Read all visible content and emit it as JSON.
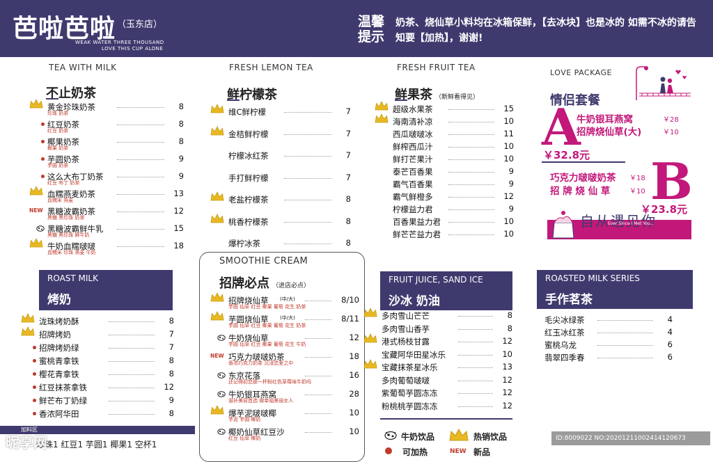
{
  "header": {
    "brand": "芭啦芭啦",
    "branch": "（玉东店）",
    "slogan_line1": "WEAK WATER THREE THOUSAND",
    "slogan_line2": "LOVE THIS CUP ALONE",
    "notice_label": "温馨提示",
    "notice_text": "奶茶、烧仙草小料均在冰箱保鲜，【去冰块】也是冰的 如需不冰的请告知要【加热】，谢谢!"
  },
  "milk_tea": {
    "en": "TEA WITH MILK",
    "cn": "不止奶茶",
    "items": [
      {
        "name": "黄金珍珠奶茶",
        "desc": "珍珠 奶茶",
        "price": "8"
      },
      {
        "name": "红豆奶茶",
        "desc": "红豆 奶茶",
        "price": "8"
      },
      {
        "name": "椰果奶茶",
        "desc": "椰果 奶茶",
        "price": "8"
      },
      {
        "name": "芋圆奶茶",
        "desc": "芋圆 奶茶",
        "price": "9"
      },
      {
        "name": "这么大布丁奶茶",
        "desc": "红豆 布丁 奶茶",
        "price": "9"
      },
      {
        "name": "血糯燕麦奶茶",
        "desc": "血糯米 燕麦",
        "price": "13"
      },
      {
        "name": "黑糖波霸奶茶",
        "desc": "黑糖 黑珍珠 奶茶",
        "price": "12"
      },
      {
        "name": "黑糖波霸鲜牛乳",
        "desc": "黑糖 黑珍珠 鲜牛奶",
        "price": "15"
      },
      {
        "name": "牛奶血糯啵啵",
        "desc": "血糯米 珍珠 燕麦 牛奶",
        "price": "18"
      }
    ]
  },
  "roast_milk": {
    "en": "ROAST MILK",
    "cn": "烤奶",
    "items": [
      {
        "name": "泷珠烤奶酥",
        "price": "8"
      },
      {
        "name": "招牌烤奶",
        "price": "7"
      },
      {
        "name": "招牌烤奶绿",
        "price": "7"
      },
      {
        "name": "蜜桃青拿铁",
        "price": "8"
      },
      {
        "name": "樱花青拿铁",
        "price": "8"
      },
      {
        "name": "红豆抹茶拿铁",
        "price": "12"
      },
      {
        "name": "鲜芒布丁奶绿",
        "price": "9"
      },
      {
        "name": "香浓阿华田",
        "price": "8"
      }
    ]
  },
  "addons": {
    "label": "加料区",
    "line": "珍珠1 红豆1 芋圆1 椰果1 空杯1"
  },
  "lemon_tea": {
    "en": "FRESH LEMON TEA",
    "cn": "鲜柠檬茶",
    "items": [
      {
        "name": "维C鲜柠檬",
        "price": "7"
      },
      {
        "name": "金桔鲜柠檬",
        "price": "7"
      },
      {
        "name": "柠檬冰红茶",
        "price": "7"
      },
      {
        "name": "手打鲜柠檬",
        "price": "7"
      },
      {
        "name": "老盐柠檬茶",
        "price": "8"
      },
      {
        "name": "桃香柠檬茶",
        "price": "8"
      },
      {
        "name": "爆柠冰茶",
        "price": "8"
      }
    ]
  },
  "smoothie": {
    "en": "SMOOTHIE CREAM",
    "cn": "招牌必点",
    "sub": "（进店必点）",
    "items": [
      {
        "name": "招牌烧仙草",
        "size": "(中/大)",
        "desc": "芋圆 仙草 红豆 椰果 葡萄 花生 奶茶",
        "price": "8/10"
      },
      {
        "name": "芋圆烧仙草",
        "size": "(中/大)",
        "desc": "芋圆 仙草 红豆 椰果 葡萄 花生 奶茶",
        "price": "8/11"
      },
      {
        "name": "牛奶烧仙草",
        "size": "",
        "desc": "芋圆 仙草 红豆 椰果 葡萄 花生 牛奶",
        "price": "12"
      },
      {
        "name": "巧克力啵啵奶茶",
        "size": "",
        "desc": "香浓巧克力奶茶 沉浸恋爱之中",
        "price": "18"
      },
      {
        "name": "东京花落",
        "size": "",
        "desc": "还记得初恋那一杯粉红色草莓味牛奶吗",
        "price": "16"
      },
      {
        "name": "牛奶银耳燕窝",
        "size": "",
        "desc": "滋补美容首选 做幸福美丽女人",
        "price": "28"
      },
      {
        "name": "爆芋泥啵啵椰",
        "size": "",
        "desc": "芋泥 芋圆 椰奶",
        "price": "10"
      },
      {
        "name": "椰奶仙草红豆沙",
        "size": "",
        "desc": "红豆 仙草 椰奶",
        "price": "10"
      }
    ]
  },
  "fruit_tea": {
    "en": "FRESH FRUIT TEA",
    "cn": "鲜果茶",
    "sub": "（新鲜看得见）",
    "items": [
      {
        "name": "超级水果茶",
        "price": "15"
      },
      {
        "name": "海南清补凉",
        "price": "10"
      },
      {
        "name": "西瓜啵啵冰",
        "price": "11"
      },
      {
        "name": "鲜榨西瓜汁",
        "price": "10"
      },
      {
        "name": "鲜打芒果汁",
        "price": "10"
      },
      {
        "name": "泰芒百香果",
        "price": "9"
      },
      {
        "name": "霸气百香果",
        "price": "9"
      },
      {
        "name": "霸气鲜橙多",
        "price": "12"
      },
      {
        "name": "柠檬益力君",
        "price": "9"
      },
      {
        "name": "百香果益力君",
        "price": "10"
      },
      {
        "name": "鲜芒芒益力君",
        "price": "10"
      }
    ]
  },
  "fruit_juice": {
    "en": "FRUIT JUICE, SAND ICE",
    "cn": "沙冰 奶油",
    "items": [
      {
        "name": "多肉雪山芒芒",
        "price": "8"
      },
      {
        "name": "多肉雪山香芋",
        "price": "8"
      },
      {
        "name": "港式杨枝甘露",
        "price": "12"
      },
      {
        "name": "宝藏阿华田星冰乐",
        "price": "10"
      },
      {
        "name": "宝藏抹茶星冰乐",
        "price": "13"
      },
      {
        "name": "多肉葡萄啵啵",
        "price": "12"
      },
      {
        "name": "紫葡萄芋圆冻冻",
        "price": "12"
      },
      {
        "name": "粉桃桃芋圆冻冻",
        "price": "12"
      }
    ]
  },
  "legend": {
    "milk": "牛奶饮品",
    "hot": "热销饮品",
    "heat": "可加热",
    "new": "新品",
    "new_tag": "NEW"
  },
  "package": {
    "en": "LOVE PACKAGE",
    "cn": "情侣套餐",
    "a_letter": "A",
    "a_item1": "牛奶银耳燕窝",
    "a_price1": "￥28",
    "a_item2": "招牌烧仙草(大)",
    "a_price2": "￥10",
    "a_total": "￥32.8元",
    "b_letter": "B",
    "b_item1": "巧克力啵啵奶茶",
    "b_price1": "￥18",
    "b_item2": "招 牌 烧 仙 草",
    "b_price2": "￥10",
    "b_total": "￥23.8元",
    "tagline": "自从遇见你",
    "tagline_en": "Ever Since I Met You..."
  },
  "roasted_series": {
    "en": "ROASTED MILK SERIES",
    "cn": "手作茗茶",
    "items": [
      {
        "name": "毛尖冰绿茶",
        "price": "4"
      },
      {
        "name": "红玉冰红茶",
        "price": "4"
      },
      {
        "name": "蜜桃乌龙",
        "price": "6"
      },
      {
        "name": "翡翠四季春",
        "price": "6"
      }
    ]
  },
  "footer": {
    "watermark": "昵享网",
    "image_id": "ID:8009022 NO:20201211002414120673"
  },
  "colors": {
    "brand": "#3f3a6e",
    "accent": "#c2187a",
    "desc": "#c0392b",
    "crown": "#e8b923"
  }
}
